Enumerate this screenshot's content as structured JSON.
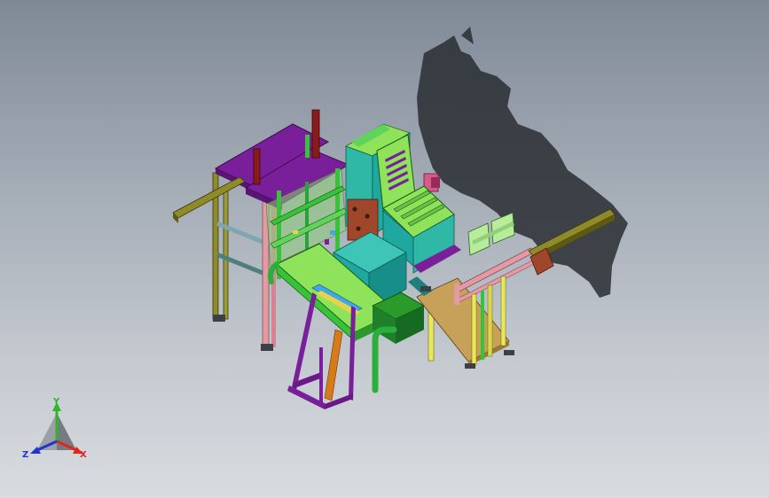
{
  "viewport": {
    "background_top": "#7f8996",
    "background_bottom": "#d8dbdf"
  },
  "triad": {
    "x_label": "X",
    "y_label": "Y",
    "z_label": "Z",
    "x_color": "#e0261c",
    "y_color": "#2fb52a",
    "z_color": "#2233cc"
  },
  "colors": {
    "purple_top": "#7a1f9a",
    "light_green": "#8fe35a",
    "teal_box": "#1fa8a0",
    "green_frame": "#38c23a",
    "pink_bar": "#e29aa4",
    "tan_plate": "#c7a15a",
    "olive_beam": "#8f8a2a",
    "shadow": "#2a2e33"
  }
}
